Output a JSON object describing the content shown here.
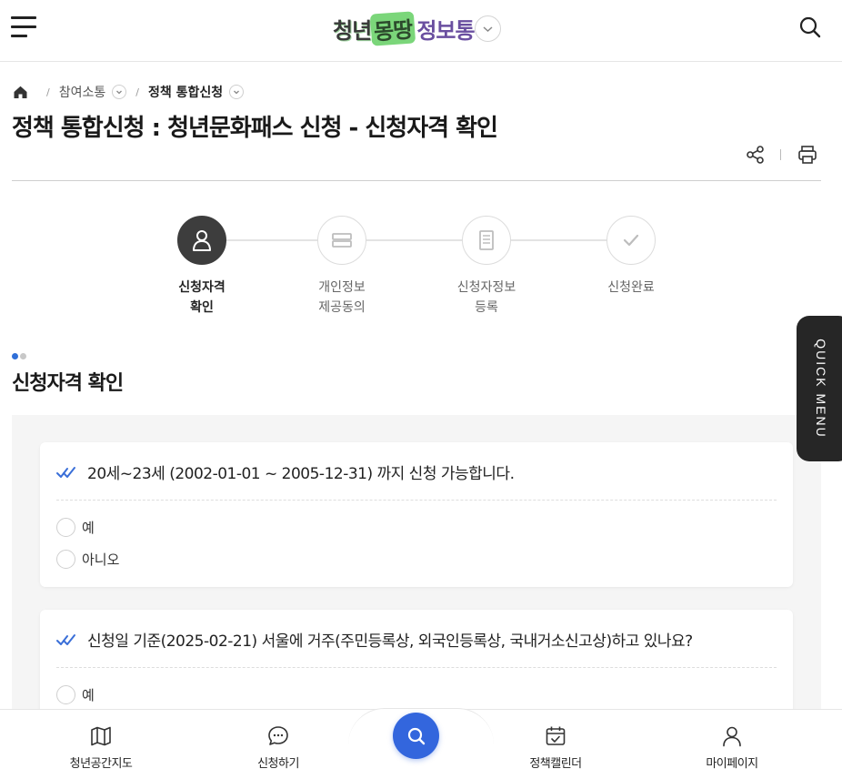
{
  "header": {
    "logo_part1": "청년",
    "logo_part2": "몽땅",
    "logo_part3": "정보통",
    "menu_icon": "hamburger-icon",
    "search_icon": "search-icon"
  },
  "breadcrumb": {
    "home_icon": "home-icon",
    "items": [
      {
        "label": "참여소통"
      },
      {
        "label": "정책 통합신청"
      }
    ]
  },
  "page_title": "정책 통합신청 : 청년문화패스 신청 - 신청자격 확인",
  "tools": {
    "share_icon": "share-icon",
    "print_icon": "print-icon"
  },
  "steps": [
    {
      "label": "신청자격\n확인",
      "icon": "person-icon",
      "active": true
    },
    {
      "label": "개인정보\n제공동의",
      "icon": "card-icon",
      "active": false
    },
    {
      "label": "신청자정보\n등록",
      "icon": "document-icon",
      "active": false
    },
    {
      "label": "신청완료",
      "icon": "check-icon",
      "active": false
    }
  ],
  "section_title": "신청자격 확인",
  "questions": [
    {
      "text": "20세~23세 (2002-01-01 ~ 2005-12-31) 까지 신청 가능합니다.",
      "options": [
        "예",
        "아니오"
      ]
    },
    {
      "text": "신청일 기준(2025-02-21) 서울에 거주(주민등록상, 외국인등록상, 국내거소신고상)하고 있나요?",
      "options": [
        "예"
      ]
    }
  ],
  "quick_menu_label": "QUICK MENU",
  "bottom_nav": {
    "items": [
      {
        "label": "청년공간지도",
        "icon": "map-icon"
      },
      {
        "label": "신청하기",
        "icon": "chat-icon"
      },
      {
        "label": "정책캘린더",
        "icon": "calendar-icon"
      },
      {
        "label": "마이페이지",
        "icon": "user-icon"
      }
    ],
    "fab_icon": "search-icon"
  },
  "colors": {
    "accent": "#3366dd",
    "active_step": "#3d3d3d",
    "dot_active": "#2f6fd8",
    "dot_inactive": "#c8c8c8",
    "quick_menu_bg": "#262626"
  }
}
